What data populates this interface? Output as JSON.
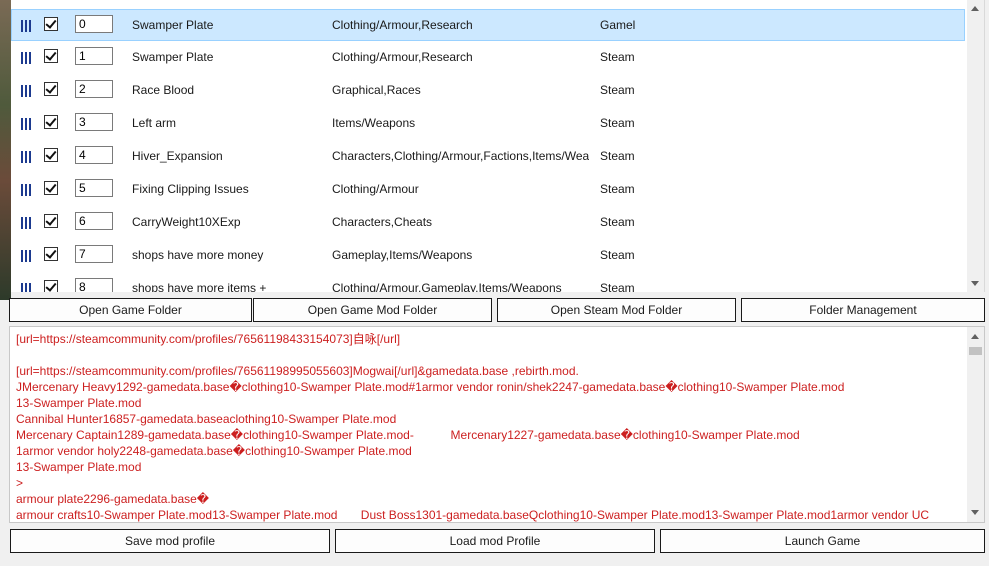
{
  "mods": [
    {
      "order": "0",
      "name": "Swamper Plate",
      "categories": "Clothing/Armour,Research",
      "source": "Gamel",
      "selected": true
    },
    {
      "order": "1",
      "name": "Swamper Plate",
      "categories": "Clothing/Armour,Research",
      "source": "Steam"
    },
    {
      "order": "2",
      "name": "Race Blood",
      "categories": "Graphical,Races",
      "source": "Steam"
    },
    {
      "order": "3",
      "name": "Left arm",
      "categories": "Items/Weapons",
      "source": "Steam"
    },
    {
      "order": "4",
      "name": "Hiver_Expansion",
      "categories": "Characters,Clothing/Armour,Factions,Items/Weap",
      "source": "Steam"
    },
    {
      "order": "5",
      "name": "Fixing Clipping Issues",
      "categories": "Clothing/Armour",
      "source": "Steam"
    },
    {
      "order": "6",
      "name": "CarryWeight10XExp",
      "categories": "Characters,Cheats",
      "source": "Steam"
    },
    {
      "order": "7",
      "name": "shops have more money",
      "categories": "Gameplay,Items/Weapons",
      "source": "Steam"
    },
    {
      "order": "8",
      "name": "shops have more items +",
      "categories": "Clothing/Armour,Gameplay,Items/Weapons",
      "source": "Steam"
    }
  ],
  "folder_buttons": {
    "open_game_folder": "Open Game Folder",
    "open_game_mod_folder": "Open Game Mod Folder",
    "open_steam_mod_folder": "Open Steam Mod Folder",
    "folder_management": "Folder Management"
  },
  "log_lines": [
    "[url=https://steamcommunity.com/profiles/76561198433154073]自咏[/url]",
    "",
    "[url=https://steamcommunity.com/profiles/76561198995055603]Mogwai[/url]&gamedata.base ,rebirth.mod.",
    "JMercenary Heavy1292-gamedata.base�clothing10-Swamper Plate.mod#1armor vendor ronin/shek2247-gamedata.base�clothing10-Swamper Plate.mod",
    "13-Swamper Plate.mod",
    "Cannibal Hunter16857-gamedata.baseaclothing10-Swamper Plate.mod",
    "Mercenary Captain1289-gamedata.base�clothing10-Swamper Plate.mod-           Mercenary1227-gamedata.base�clothing10-Swamper Plate.mod",
    "1armor vendor holy2248-gamedata.base�clothing10-Swamper Plate.mod",
    "13-Swamper Plate.mod",
    ">",
    "armour plate2296-gamedata.base�",
    "armour crafts10-Swamper Plate.mod13-Swamper Plate.mod       Dust Boss1301-gamedata.baseQclothing10-Swamper Plate.mod13-Swamper Plate.mod1armor vendor UC"
  ],
  "bottom_buttons": {
    "save_profile": "Save mod profile",
    "load_profile": "Load mod Profile",
    "launch_game": "Launch Game"
  },
  "colors": {
    "selection": "#cce8ff",
    "log_text": "#cc1f1f",
    "drag_handle": "#1c3a8f"
  }
}
